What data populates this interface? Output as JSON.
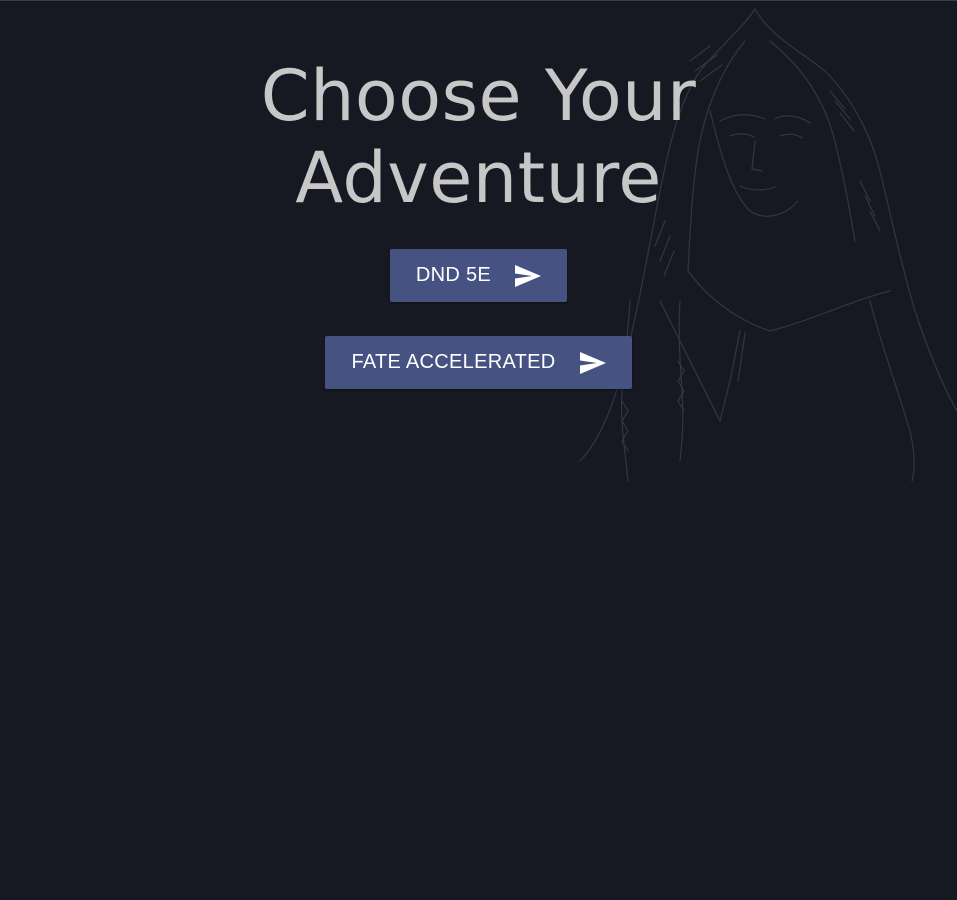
{
  "page": {
    "background_color": "#171922",
    "accent_color": "#465282"
  },
  "hero": {
    "title_line1": "Choose Your",
    "title_line2": "Adventure",
    "illustration": "hooded-figure-sketch"
  },
  "buttons": [
    {
      "label": "DND 5E",
      "icon": "send-icon"
    },
    {
      "label": "FATE ACCELERATED",
      "icon": "send-icon"
    }
  ]
}
